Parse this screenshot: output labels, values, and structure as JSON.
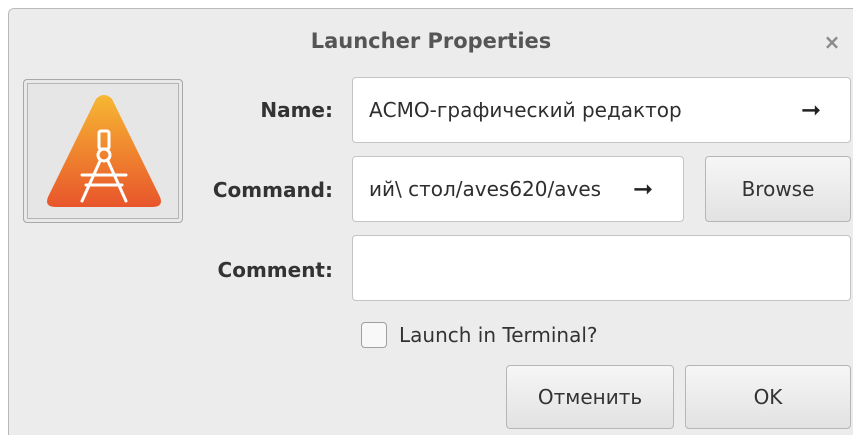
{
  "dialog": {
    "title": "Launcher Properties",
    "close_glyph": "×"
  },
  "icon": {
    "name": "drafting-compass-icon",
    "colors": {
      "triangle_top": "#f7b733",
      "triangle_bottom": "#e8552b",
      "drawing": "#ffffff"
    }
  },
  "form": {
    "name_label": "Name:",
    "name_value": "АСМО-графический редактор",
    "command_label": "Command:",
    "command_value": "ий\\ стол/aves620/aves",
    "comment_label": "Comment:",
    "comment_value": "",
    "arrow_glyph": "➞",
    "browse_label": "Browse",
    "terminal_label": "Launch in Terminal?",
    "terminal_checked": false
  },
  "buttons": {
    "cancel_label": "Отменить",
    "ok_label": "OK"
  }
}
